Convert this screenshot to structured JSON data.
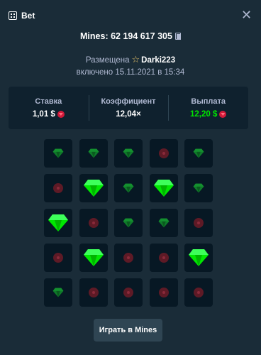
{
  "header": {
    "title": "Bet",
    "title_icon": "bet-grid-icon",
    "close_icon": "close-icon"
  },
  "bet": {
    "game_id": "Mines: 62 194 617 305",
    "placed_label": "Размещена",
    "user": "Darki223",
    "date": "включено 15.11.2021 в 15:34"
  },
  "stats": {
    "wager_label": "Ставка",
    "wager_value": "1,01 $",
    "multiplier_label": "Коэффициент",
    "multiplier_value": "12,04×",
    "payout_label": "Выплата",
    "payout_value": "12,20 $"
  },
  "board": {
    "rows": [
      [
        "gem",
        "gem",
        "gem",
        "mine",
        "gem"
      ],
      [
        "mine",
        "gem-revealed",
        "gem",
        "gem-revealed",
        "gem"
      ],
      [
        "gem-revealed",
        "mine",
        "gem",
        "gem",
        "mine"
      ],
      [
        "mine",
        "gem-revealed",
        "mine",
        "mine",
        "gem-revealed"
      ],
      [
        "gem",
        "mine",
        "mine",
        "mine",
        "mine"
      ]
    ]
  },
  "actions": {
    "play_label": "Играть в Mines"
  },
  "colors": {
    "background": "#1a2c38",
    "panel": "#0f212e",
    "tile": "#071824",
    "green": "#00e701",
    "mine_red": "#5e1a26"
  }
}
